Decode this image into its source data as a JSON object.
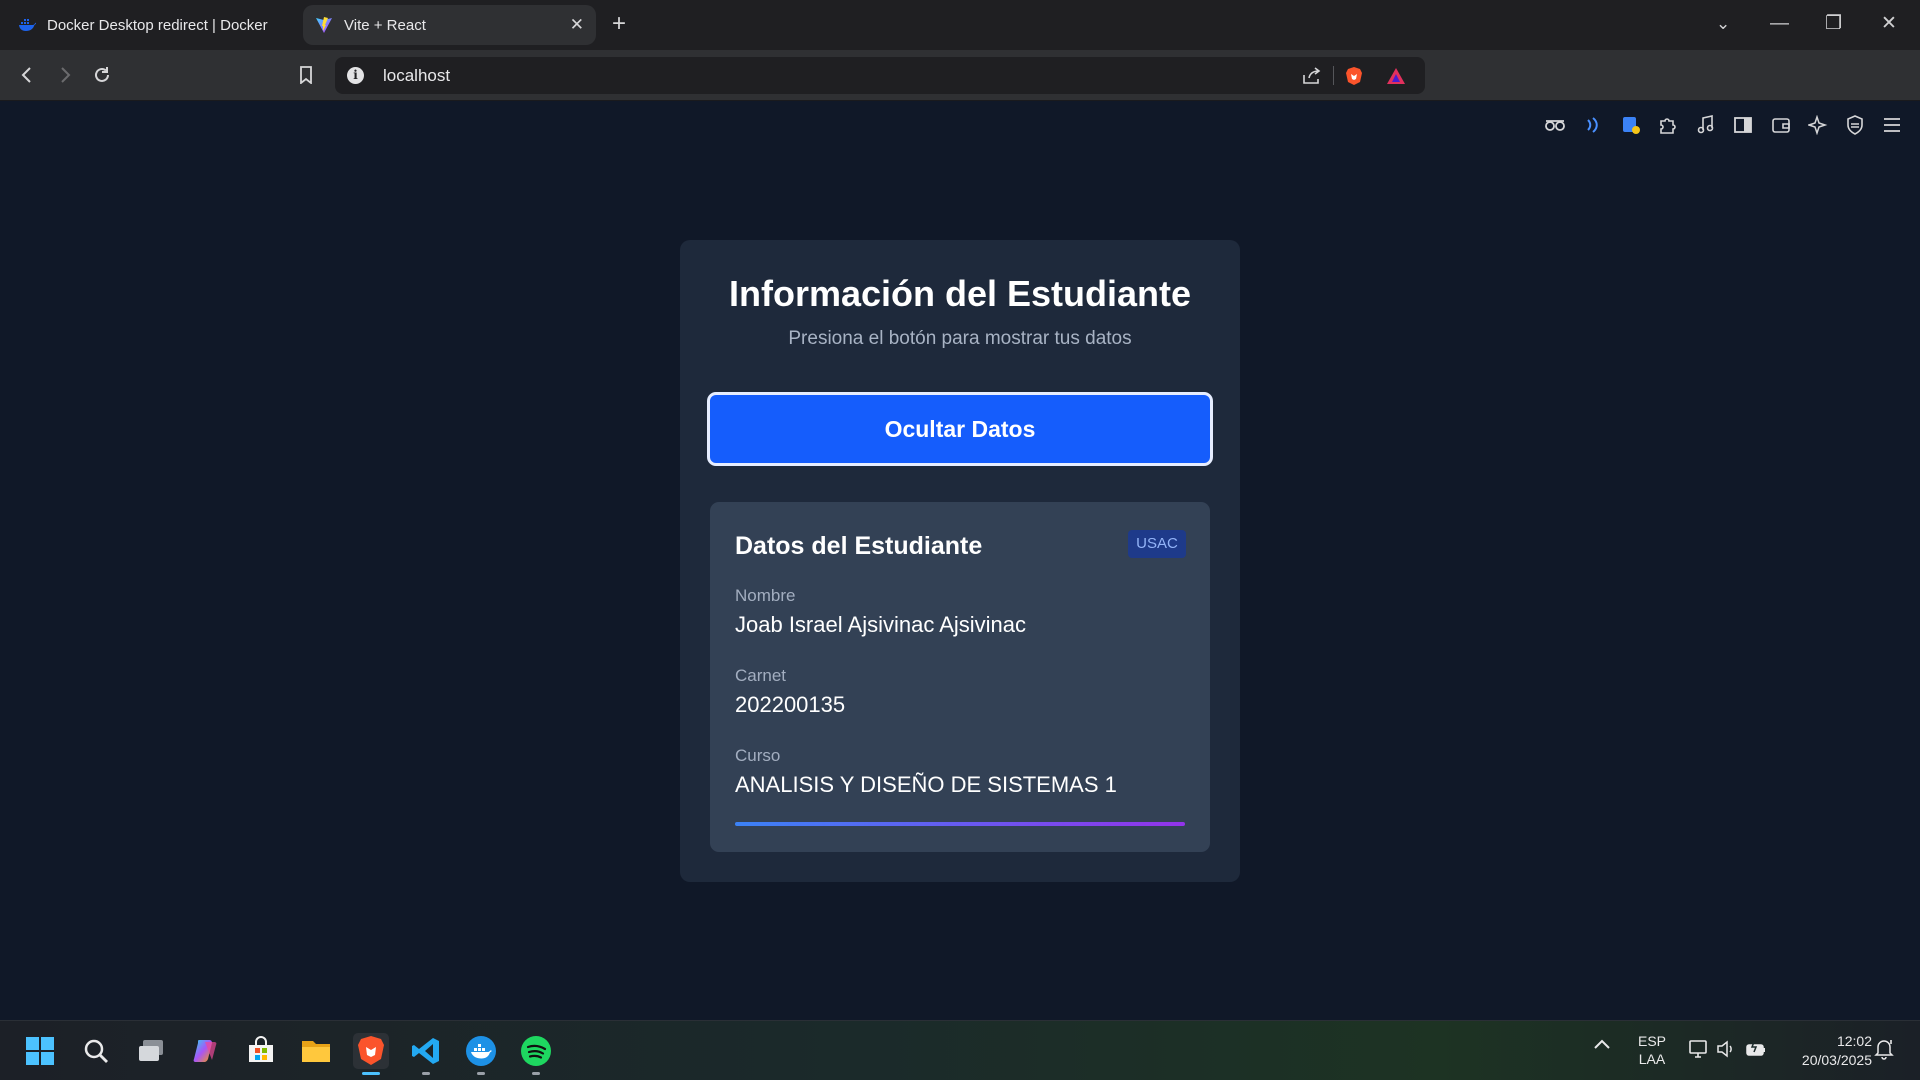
{
  "browser": {
    "tabs": [
      {
        "title": "Docker Desktop redirect | Docker",
        "favicon": "docker-icon",
        "active": false
      },
      {
        "title": "Vite + React",
        "favicon": "vite-icon",
        "active": true
      }
    ],
    "address_bar": {
      "url": "localhost"
    }
  },
  "page": {
    "title": "Información del Estudiante",
    "subtitle": "Presiona el botón para mostrar tus datos",
    "toggle_button_label": "Ocultar Datos",
    "details": {
      "title": "Datos del Estudiante",
      "badge": "USAC",
      "fields": [
        {
          "label": "Nombre",
          "value": "Joab Israel Ajsivinac Ajsivinac"
        },
        {
          "label": "Carnet",
          "value": "202200135"
        },
        {
          "label": "Curso",
          "value": "ANALISIS Y DISEÑO DE SISTEMAS 1"
        }
      ]
    }
  },
  "taskbar": {
    "language": {
      "line1": "ESP",
      "line2": "LAA"
    },
    "clock": {
      "time": "12:02",
      "date": "20/03/2025"
    }
  },
  "colors": {
    "page_bg": "#101828",
    "card_bg": "#1e293b",
    "panel_bg": "#334155",
    "accent_button": "#155dfc",
    "gradient_start": "#3b82f6",
    "gradient_end": "#9333ea"
  }
}
